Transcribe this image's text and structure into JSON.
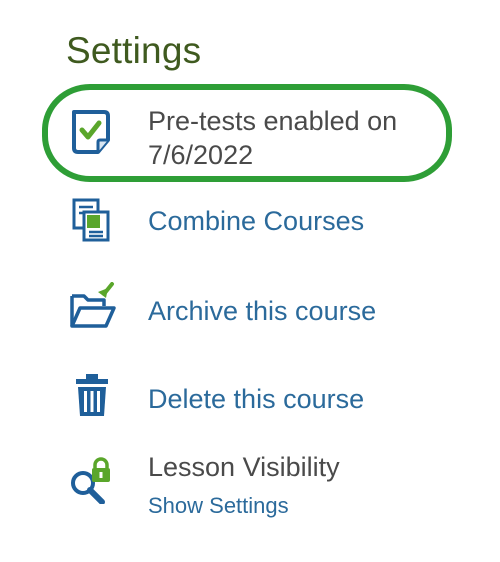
{
  "settings": {
    "title": "Settings",
    "items": [
      {
        "label_line1": "Pre-tests enabled on",
        "label_line2": "7/6/2022",
        "icon": "checklist-icon"
      },
      {
        "label": "Combine Courses",
        "icon": "copy-pages-icon"
      },
      {
        "label": "Archive this course",
        "icon": "archive-folder-icon"
      },
      {
        "label": "Delete this course",
        "icon": "trash-icon"
      },
      {
        "label": "Lesson Visibility",
        "sublabel": "Show Settings",
        "icon": "lock-magnifier-icon"
      }
    ]
  },
  "colors": {
    "heading": "#3f5a1f",
    "link": "#2b6a9b",
    "icon_blue": "#1f5f9a",
    "icon_green": "#5aa62b",
    "highlight": "#2e9e36"
  }
}
